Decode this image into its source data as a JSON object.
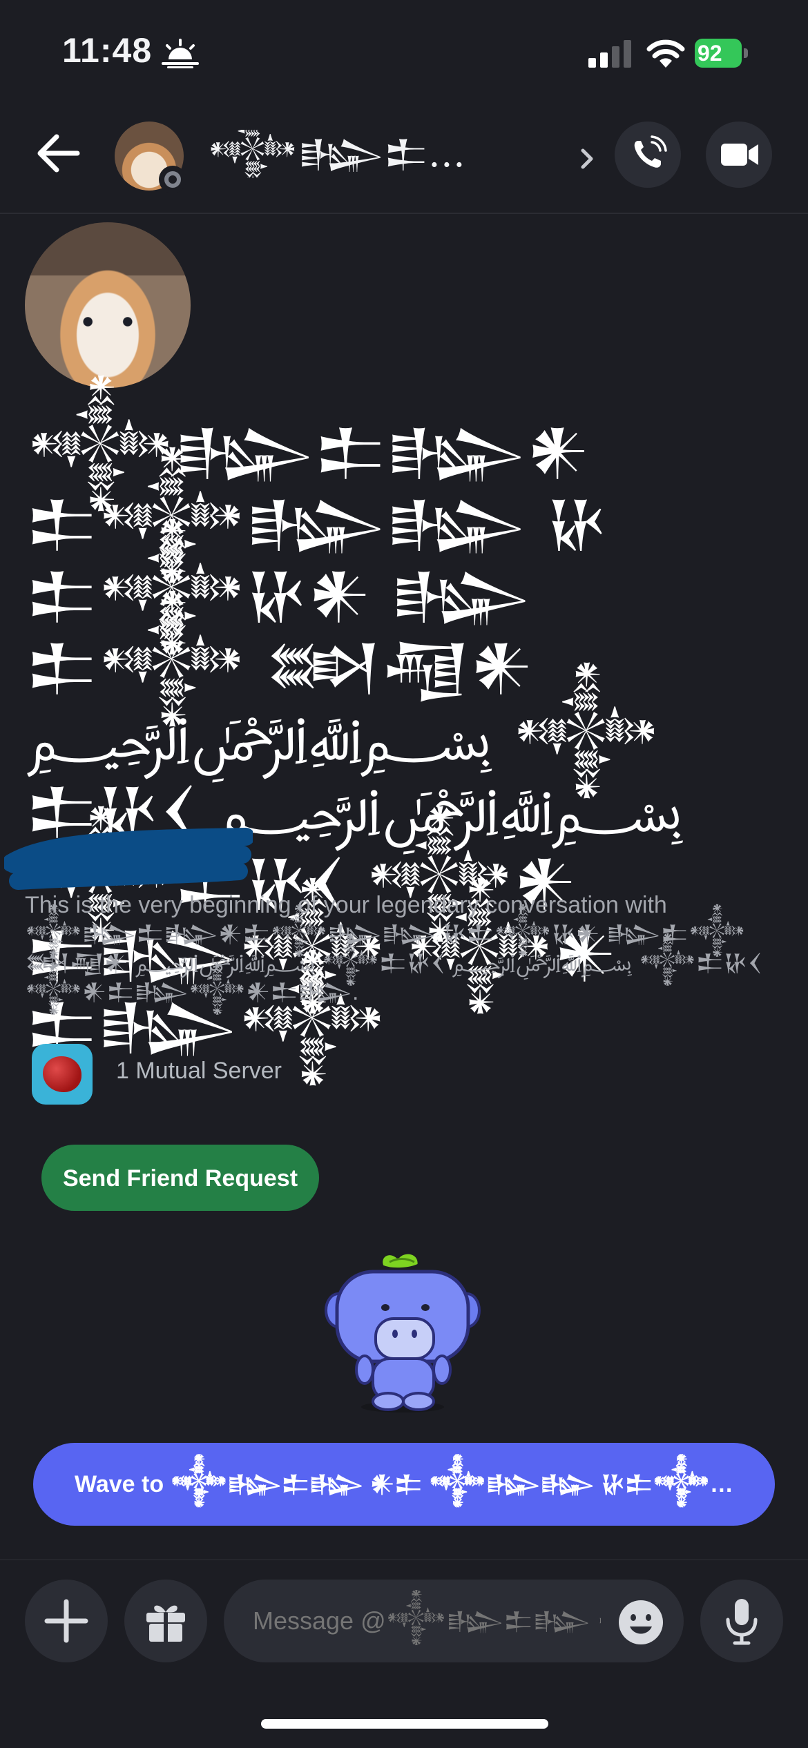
{
  "status_bar": {
    "time": "11:48",
    "battery": "92",
    "icons": [
      "sun-icon",
      "signal-icon",
      "wifi-icon",
      "battery-icon"
    ]
  },
  "header": {
    "title": "𒀱𒈗𒉺𒈗𒀭𒉺 ...",
    "icons": [
      "back-arrow-icon",
      "chevron-right-icon",
      "phone-icon",
      "video-camera-icon"
    ]
  },
  "profile": {
    "display_name": "𒀱𒈗𒉺𒈗𒀭𒉺𒀱𒈗𒈗 𒄩𒉺𒀱𒄩𒀭 𒈗𒉺𒀱 𒇷𒆷𒀭 ﷽ 𒀱𒉺𒄩𒌋 ﷽ 𒀱𒉺𒄩𒌋 𒀱𒀭𒉺𒈗𒀱 𒀱𒀭𒉺𒈗𒀱",
    "intro_text": "This is the very beginning of your legendary conversation with 𒀱𒈗𒉺𒈗𒀭𒉺𒀱𒈗𒈗 𒄩𒉺𒀱𒄩𒀭 𒈗𒉺𒀱 𒇷𒆷𒀭 ﷽ 𒀱𒉺𒄩𒌋 ﷽ 𒀱𒉺𒄩𒌋 𒀱𒀭𒉺𒈗𒀱𒀭𒉺𒈗.",
    "mutual_servers_label": "1 Mutual Server",
    "send_friend_request_label": "Send Friend Request"
  },
  "wave_button": {
    "label": "Wave to 𒀱𒈗𒉺𒈗 𒀭𒉺 𒀱𒈗𒈗 𒄩𒉺𒀱𒄩𒀭 𒈗𒉺𒀱..."
  },
  "composer": {
    "placeholder": "Message @𒀱𒈗𒉺𒈗 𒀭𒉺..."
  },
  "colors": {
    "background": "#1c1d23",
    "blurple": "#5865f2",
    "green": "#248046",
    "battery_green": "#34c759"
  }
}
